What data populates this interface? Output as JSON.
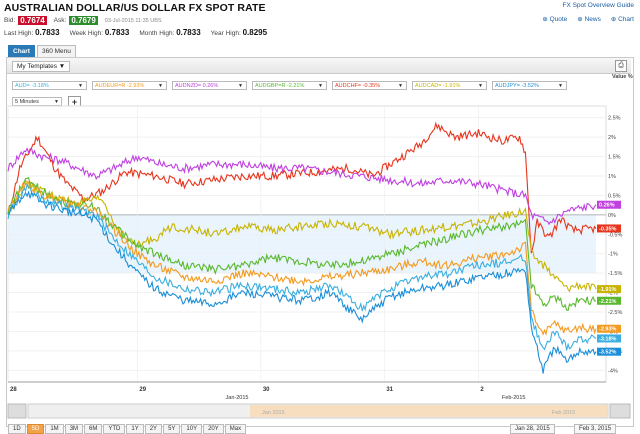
{
  "header": {
    "title": "AUSTRALIAN DOLLAR/US DOLLAR FX SPOT RATE",
    "overview_link": "FX Spot Overview Guide",
    "bid_label": "Bid:",
    "bid_value": "0.7674",
    "ask_label": "Ask:",
    "ask_value": "0.7679",
    "timestamp": "03-Jul-2015 11:35 UBS",
    "links": {
      "quote": "Quote",
      "news": "News",
      "chart": "Chart"
    },
    "stats": [
      {
        "label": "Last High:",
        "value": "0.7833"
      },
      {
        "label": "Week High:",
        "value": "0.7833"
      },
      {
        "label": "Month High:",
        "value": "0.7833"
      },
      {
        "label": "Year High:",
        "value": "0.8295"
      }
    ]
  },
  "tabs": [
    {
      "label": "Chart",
      "active": true
    },
    {
      "label": "360 Menu",
      "active": false
    }
  ],
  "toolbar": {
    "templates_label": "My Templates ▼",
    "print_icon": "print-icon"
  },
  "series_selectors": [
    {
      "label": "AUD= -3.18%",
      "color": "#3aaee0"
    },
    {
      "label": "AUDEUR=R -2.93%",
      "color": "#f39a1f"
    },
    {
      "label": "AUDNZD= 0.26%",
      "color": "#c040e0"
    },
    {
      "label": "AUDGBP=R -2.21%",
      "color": "#5ab82e"
    },
    {
      "label": "AUDCHF= -0.35%",
      "color": "#e8341c"
    },
    {
      "label": "AUDCAD= -1.91%",
      "color": "#c8b400"
    },
    {
      "label": "AUDJPY= -3.52%",
      "color": "#1a8ed8"
    }
  ],
  "interval": {
    "label": "5 Minutes"
  },
  "value_header": "Value %",
  "chart_data": {
    "type": "line",
    "x_labels": [
      "28",
      "29",
      "30",
      "31",
      "2"
    ],
    "x_month_labels": [
      "Jan-2015",
      "Feb-2015"
    ],
    "y_ticks": [
      "2.5%",
      "2%",
      "1.5%",
      "1%",
      "0.5%",
      "0%",
      "-0.5%",
      "-1%",
      "-1.5%",
      "-2%",
      "-2.5%",
      "-3%",
      "-3.5%",
      "-4%"
    ],
    "ylim": [
      -4.3,
      2.8
    ],
    "grid": true,
    "series": [
      {
        "name": "AUDCHF=",
        "color": "#e8341c",
        "end_label": "-0.35%",
        "points": [
          [
            0,
            0.0
          ],
          [
            2,
            1.2
          ],
          [
            5,
            2.0
          ],
          [
            8,
            1.2
          ],
          [
            10,
            0.8
          ],
          [
            13,
            0.4
          ],
          [
            16,
            0.6
          ],
          [
            20,
            1.1
          ],
          [
            25,
            1.0
          ],
          [
            30,
            0.8
          ],
          [
            35,
            0.9
          ],
          [
            40,
            1.0
          ],
          [
            45,
            1.0
          ],
          [
            52,
            1.1
          ],
          [
            58,
            1.2
          ],
          [
            62,
            1.0
          ],
          [
            66,
            1.4
          ],
          [
            70,
            1.8
          ],
          [
            73,
            2.3
          ],
          [
            76,
            2.0
          ],
          [
            80,
            2.1
          ],
          [
            84,
            1.9
          ],
          [
            87,
            2.0
          ],
          [
            88,
            1.6
          ],
          [
            89,
            -1.0
          ],
          [
            90,
            -0.2
          ],
          [
            92,
            -0.6
          ],
          [
            94,
            -0.1
          ],
          [
            96,
            -0.4
          ],
          [
            100,
            -0.35
          ]
        ]
      },
      {
        "name": "AUDNZD=",
        "color": "#c040e0",
        "end_label": "0.26%",
        "points": [
          [
            0,
            1.2
          ],
          [
            3,
            1.7
          ],
          [
            6,
            1.5
          ],
          [
            9,
            1.4
          ],
          [
            12,
            1.2
          ],
          [
            15,
            1.0
          ],
          [
            18,
            1.2
          ],
          [
            22,
            1.5
          ],
          [
            26,
            1.3
          ],
          [
            30,
            1.2
          ],
          [
            35,
            1.3
          ],
          [
            40,
            1.3
          ],
          [
            45,
            1.2
          ],
          [
            50,
            1.2
          ],
          [
            55,
            1.1
          ],
          [
            60,
            1.0
          ],
          [
            65,
            0.9
          ],
          [
            70,
            0.8
          ],
          [
            75,
            0.9
          ],
          [
            80,
            0.8
          ],
          [
            85,
            0.6
          ],
          [
            88,
            0.5
          ],
          [
            89,
            0.0
          ],
          [
            92,
            -0.2
          ],
          [
            95,
            0.1
          ],
          [
            100,
            0.26
          ]
        ]
      },
      {
        "name": "AUDCAD=",
        "color": "#c8b400",
        "end_label": "-1.91%",
        "points": [
          [
            0,
            0.1
          ],
          [
            3,
            0.8
          ],
          [
            6,
            0.6
          ],
          [
            9,
            0.4
          ],
          [
            12,
            0.3
          ],
          [
            16,
            0.4
          ],
          [
            18,
            -0.2
          ],
          [
            20,
            -0.6
          ],
          [
            22,
            -0.8
          ],
          [
            25,
            -0.6
          ],
          [
            28,
            -0.3
          ],
          [
            32,
            -0.4
          ],
          [
            36,
            -0.5
          ],
          [
            40,
            -0.3
          ],
          [
            45,
            -0.4
          ],
          [
            50,
            -0.3
          ],
          [
            55,
            -0.2
          ],
          [
            60,
            -0.3
          ],
          [
            65,
            -0.5
          ],
          [
            70,
            -0.4
          ],
          [
            75,
            -0.3
          ],
          [
            80,
            -0.2
          ],
          [
            85,
            0.0
          ],
          [
            88,
            0.1
          ],
          [
            89,
            -1.0
          ],
          [
            91,
            -1.3
          ],
          [
            93,
            -1.6
          ],
          [
            95,
            -1.9
          ],
          [
            97,
            -1.8
          ],
          [
            100,
            -1.91
          ]
        ]
      },
      {
        "name": "AUDGBP=R",
        "color": "#5ab82e",
        "end_label": "-2.21%",
        "points": [
          [
            0,
            0.1
          ],
          [
            3,
            0.9
          ],
          [
            6,
            0.6
          ],
          [
            10,
            0.3
          ],
          [
            15,
            0.2
          ],
          [
            18,
            -0.3
          ],
          [
            22,
            -0.8
          ],
          [
            25,
            -1.0
          ],
          [
            30,
            -1.3
          ],
          [
            35,
            -1.4
          ],
          [
            40,
            -1.3
          ],
          [
            45,
            -1.1
          ],
          [
            50,
            -1.2
          ],
          [
            55,
            -1.3
          ],
          [
            60,
            -1.2
          ],
          [
            65,
            -1.0
          ],
          [
            70,
            -0.8
          ],
          [
            75,
            -0.6
          ],
          [
            80,
            -0.4
          ],
          [
            85,
            -0.3
          ],
          [
            88,
            -0.2
          ],
          [
            89,
            -1.8
          ],
          [
            91,
            -2.3
          ],
          [
            93,
            -2.1
          ],
          [
            95,
            -2.4
          ],
          [
            97,
            -2.2
          ],
          [
            100,
            -2.21
          ]
        ]
      },
      {
        "name": "AUDEUR=R",
        "color": "#f39a1f",
        "end_label": "-2.93%",
        "points": [
          [
            0,
            0.1
          ],
          [
            3,
            0.8
          ],
          [
            6,
            0.5
          ],
          [
            10,
            0.3
          ],
          [
            15,
            0.1
          ],
          [
            18,
            -0.4
          ],
          [
            22,
            -1.0
          ],
          [
            25,
            -1.3
          ],
          [
            30,
            -1.6
          ],
          [
            35,
            -1.7
          ],
          [
            40,
            -1.5
          ],
          [
            45,
            -1.6
          ],
          [
            50,
            -1.7
          ],
          [
            55,
            -1.6
          ],
          [
            60,
            -1.5
          ],
          [
            65,
            -1.4
          ],
          [
            70,
            -1.2
          ],
          [
            75,
            -1.3
          ],
          [
            80,
            -1.1
          ],
          [
            85,
            -1.0
          ],
          [
            88,
            -0.8
          ],
          [
            89,
            -2.4
          ],
          [
            91,
            -3.1
          ],
          [
            93,
            -2.8
          ],
          [
            95,
            -3.0
          ],
          [
            97,
            -2.9
          ],
          [
            100,
            -2.93
          ]
        ]
      },
      {
        "name": "AUD=",
        "color": "#3aaee0",
        "end_label": "-3.18%",
        "points": [
          [
            0,
            0.0
          ],
          [
            3,
            0.7
          ],
          [
            6,
            0.4
          ],
          [
            10,
            0.2
          ],
          [
            15,
            0.0
          ],
          [
            18,
            -0.6
          ],
          [
            22,
            -1.2
          ],
          [
            25,
            -1.6
          ],
          [
            30,
            -1.9
          ],
          [
            35,
            -2.0
          ],
          [
            40,
            -1.8
          ],
          [
            45,
            -1.9
          ],
          [
            50,
            -2.0
          ],
          [
            55,
            -1.8
          ],
          [
            60,
            -2.4
          ],
          [
            65,
            -1.9
          ],
          [
            70,
            -1.6
          ],
          [
            75,
            -1.5
          ],
          [
            80,
            -1.3
          ],
          [
            85,
            -1.2
          ],
          [
            88,
            -1.1
          ],
          [
            89,
            -2.6
          ],
          [
            91,
            -3.5
          ],
          [
            93,
            -3.0
          ],
          [
            95,
            -3.4
          ],
          [
            97,
            -3.2
          ],
          [
            100,
            -3.18
          ]
        ]
      },
      {
        "name": "AUDJPY=",
        "color": "#1a8ed8",
        "end_label": "-3.52%",
        "points": [
          [
            0,
            0.0
          ],
          [
            3,
            0.6
          ],
          [
            6,
            0.3
          ],
          [
            10,
            0.1
          ],
          [
            15,
            -0.1
          ],
          [
            18,
            -0.8
          ],
          [
            22,
            -1.5
          ],
          [
            25,
            -1.9
          ],
          [
            30,
            -2.2
          ],
          [
            35,
            -2.3
          ],
          [
            40,
            -2.0
          ],
          [
            45,
            -2.1
          ],
          [
            50,
            -2.2
          ],
          [
            55,
            -2.0
          ],
          [
            60,
            -2.7
          ],
          [
            65,
            -2.1
          ],
          [
            70,
            -1.9
          ],
          [
            75,
            -1.8
          ],
          [
            80,
            -1.6
          ],
          [
            85,
            -1.5
          ],
          [
            88,
            -1.4
          ],
          [
            89,
            -2.9
          ],
          [
            91,
            -4.0
          ],
          [
            93,
            -3.4
          ],
          [
            95,
            -3.8
          ],
          [
            97,
            -3.5
          ],
          [
            100,
            -3.52
          ]
        ]
      }
    ]
  },
  "navigator": {
    "label_left": "Jan 2015",
    "label_right": "Feb 2015"
  },
  "range_buttons": [
    {
      "label": "1D",
      "active": false
    },
    {
      "label": "5D",
      "active": true
    },
    {
      "label": "1M",
      "active": false
    },
    {
      "label": "3M",
      "active": false
    },
    {
      "label": "6M",
      "active": false
    },
    {
      "label": "YTD",
      "active": false
    },
    {
      "label": "1Y",
      "active": false
    },
    {
      "label": "2Y",
      "active": false
    },
    {
      "label": "5Y",
      "active": false
    },
    {
      "label": "10Y",
      "active": false
    },
    {
      "label": "20Y",
      "active": false
    },
    {
      "label": "Max",
      "active": false
    }
  ],
  "date_range": {
    "from": "Jan 28, 2015",
    "to": "Feb 3, 2015"
  }
}
